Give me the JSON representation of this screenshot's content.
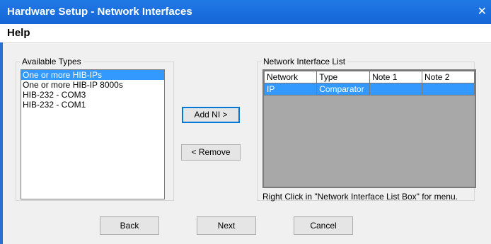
{
  "window": {
    "title": "Hardware Setup - Network Interfaces",
    "close_glyph": "✕"
  },
  "menu": {
    "help": "Help"
  },
  "available_types": {
    "label": "Available Types",
    "items": [
      "One or more HIB-IPs",
      "One or more HIB-IP 8000s",
      "HIB-232 - COM3",
      "HIB-232 - COM1"
    ],
    "selected_index": 0
  },
  "buttons": {
    "add": "Add NI >",
    "remove": "< Remove",
    "back": "Back",
    "next": "Next",
    "cancel": "Cancel"
  },
  "network_list": {
    "label": "Network Interface List",
    "columns": [
      "Network",
      "Type",
      "Note 1",
      "Note 2"
    ],
    "rows": [
      [
        "IP",
        "Comparator",
        "",
        ""
      ]
    ],
    "hint": "Right Click in \"Network Interface List Box\" for menu."
  },
  "colors": {
    "titlebar": "#1a73e8",
    "selection": "#3399ff",
    "grid_background": "#a8a8a8"
  }
}
